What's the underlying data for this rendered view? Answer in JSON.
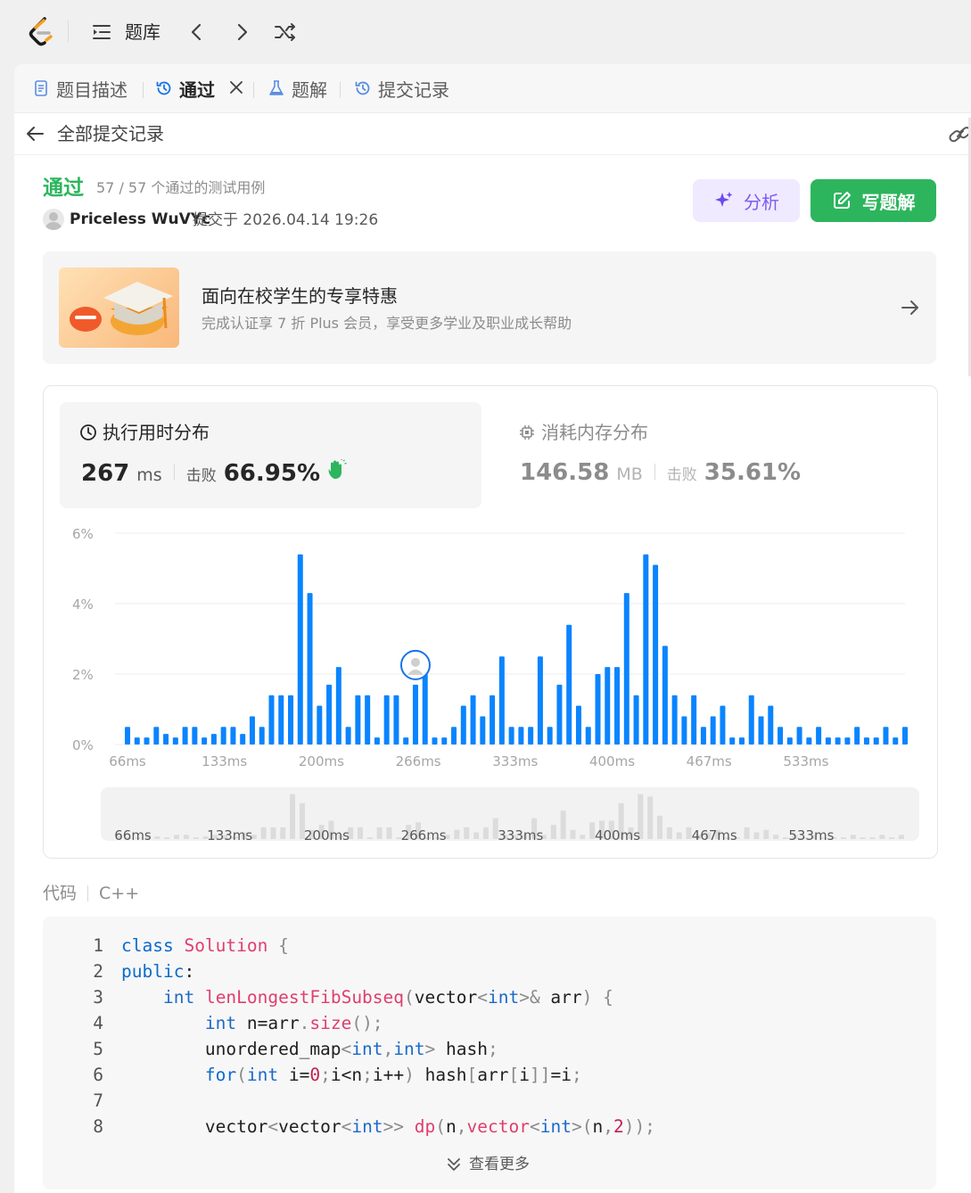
{
  "topbar": {
    "title": "题库"
  },
  "tabs": [
    {
      "label": "题目描述",
      "icon": "file-text-icon",
      "active": false
    },
    {
      "label": "通过",
      "icon": "history-icon",
      "active": true
    },
    {
      "label": "题解",
      "icon": "flask-icon",
      "active": false
    },
    {
      "label": "提交记录",
      "icon": "history-icon",
      "active": false
    }
  ],
  "back": {
    "label": "全部提交记录"
  },
  "submission": {
    "status": "通过",
    "cases": "57 / 57 个通过的测试用例",
    "author": "Priceless WuVYc",
    "submitted_at": "提交于 2026.04.14 19:26"
  },
  "actions": {
    "analyze_label": "分析",
    "write_label": "写题解"
  },
  "promo": {
    "title": "面向在校学生的专享特惠",
    "subtitle": "完成认证享 7 折 Plus 会员，享受更多学业及职业成长帮助"
  },
  "runtime": {
    "title": "执行用时分布",
    "value": "267",
    "unit": "ms",
    "beat_label": "击败",
    "beat_value": "66.95%"
  },
  "memory": {
    "title": "消耗内存分布",
    "value": "146.58",
    "unit": "MB",
    "beat_label": "击败",
    "beat_value": "35.61%"
  },
  "colors": {
    "accent_green": "#2db55d",
    "bar_blue": "#0a84ff",
    "analyze_purple": "#7b5cf0"
  },
  "chart_data": {
    "type": "bar",
    "title": "",
    "xlabel": "",
    "ylabel": "",
    "ylim": [
      0,
      6
    ],
    "y_ticks": [
      "6%",
      "4%",
      "2%",
      "0%"
    ],
    "x_ticks": [
      "66ms",
      "133ms",
      "200ms",
      "266ms",
      "333ms",
      "400ms",
      "467ms",
      "533ms"
    ],
    "grid": true,
    "marker_on_bar": 30,
    "series": [
      {
        "values": [
          0.5,
          0.2,
          0.2,
          0.5,
          0.3,
          0.2,
          0.5,
          0.5,
          0.2,
          0.3,
          0.5,
          0.5,
          0.3,
          0.8,
          0.5,
          1.4,
          1.4,
          1.4,
          5.4,
          4.3,
          1.1,
          1.7,
          2.2,
          0.5,
          1.4,
          1.4,
          0.2,
          1.4,
          1.4,
          0.2,
          1.7,
          2.0,
          0.2,
          0.2,
          0.5,
          1.1,
          1.4,
          0.8,
          1.4,
          2.5,
          0.5,
          0.5,
          0.5,
          2.5,
          0.5,
          1.7,
          3.4,
          1.1,
          0.5,
          2.0,
          2.2,
          2.2,
          4.3,
          1.4,
          5.4,
          5.1,
          2.8,
          1.4,
          0.8,
          1.4,
          0.5,
          0.8,
          1.1,
          0.2,
          0.2,
          1.4,
          0.8,
          1.1,
          0.5,
          0.2,
          0.5,
          0.2,
          0.5,
          0.2,
          0.2,
          0.2,
          0.5,
          0.2,
          0.2,
          0.5,
          0.2,
          0.5
        ]
      }
    ]
  },
  "code": {
    "label": "代码",
    "language": "C++",
    "more_label": "查看更多",
    "line_numbers": [
      "1",
      "2",
      "3",
      "4",
      "5",
      "6",
      "7",
      "8"
    ]
  }
}
